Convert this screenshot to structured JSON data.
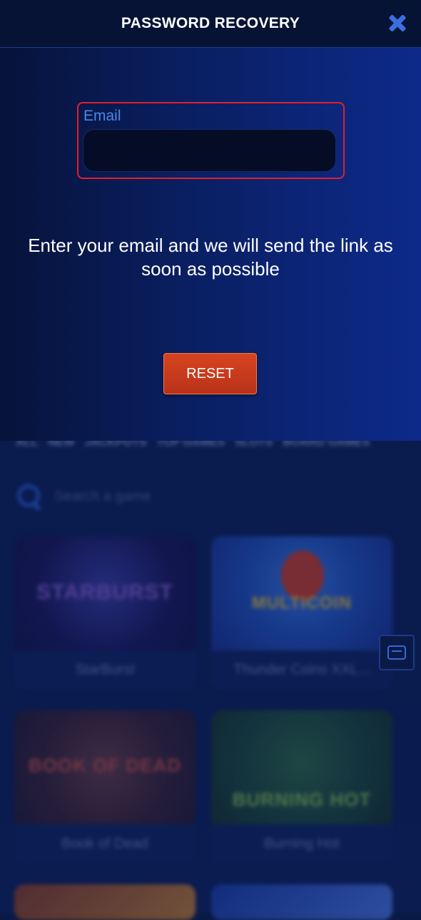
{
  "modal": {
    "title": "PASSWORD RECOVERY",
    "close_icon": "close-icon",
    "email_label": "Email",
    "email_value": "",
    "instructions": "Enter your email and we will send the link as soon as possible",
    "reset_label": "RESET"
  },
  "background": {
    "categories": [
      "ALL",
      "NEW",
      "JACKPOTS",
      "TOP GAMES",
      "SLOTS",
      "BOARD GAMES"
    ],
    "search_placeholder": "Search a game",
    "games": [
      {
        "name": "StarBurst",
        "logo": "STARBURST"
      },
      {
        "name": "Thunder Coins XXL...",
        "logo": "MULTICOIN"
      },
      {
        "name": "Book of Dead",
        "logo": "BOOK OF DEAD"
      },
      {
        "name": "Burning Hot",
        "logo": "BURNING HOT"
      }
    ]
  },
  "colors": {
    "accent_blue": "#3a6fe0",
    "reset_button": "#c93a1c",
    "highlight_border": "#e0202c"
  }
}
